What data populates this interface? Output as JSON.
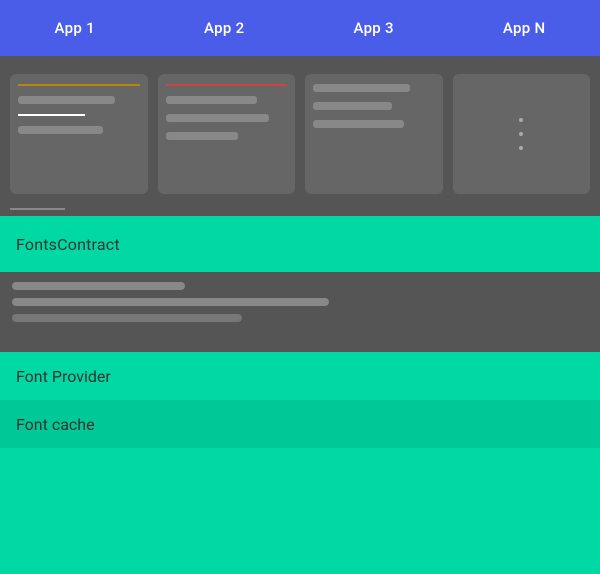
{
  "appBar": {
    "apps": [
      "App 1",
      "App 2",
      "App 3",
      "App N"
    ]
  },
  "layers": {
    "fontsContract": "FontsContract",
    "fontProvider": "Font Provider",
    "fontCache": "Font cache"
  },
  "colors": {
    "appBar": "#4A5DE8",
    "teal": "#00D9A3",
    "tealDark": "#00C896",
    "darkGray": "#555555"
  }
}
